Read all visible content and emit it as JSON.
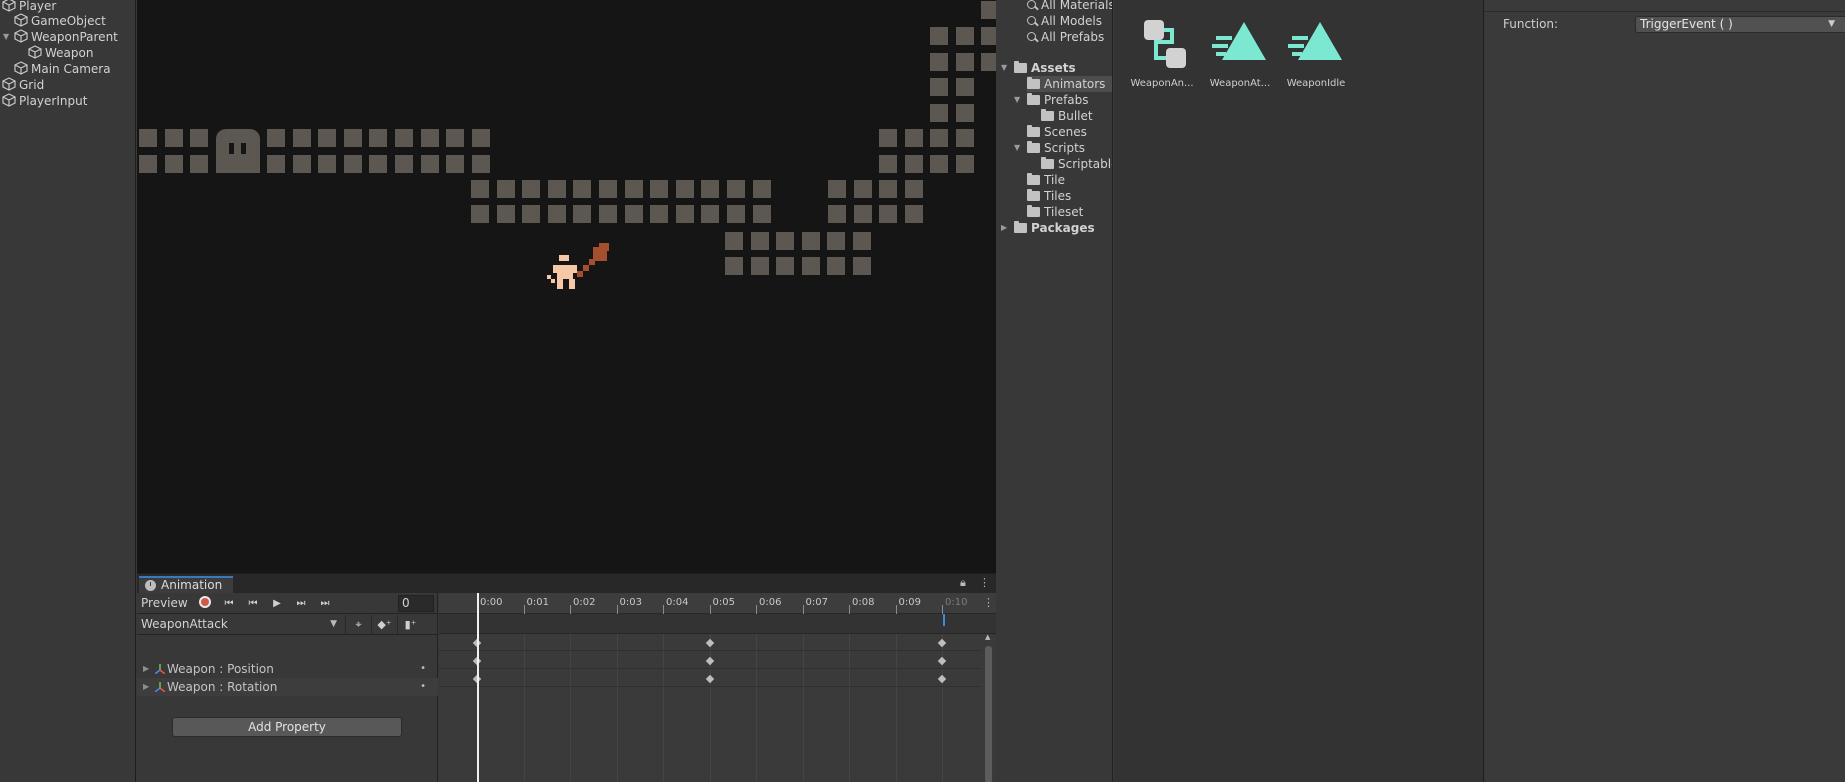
{
  "hierarchy": {
    "items": [
      {
        "label": "Player"
      },
      {
        "label": "GameObject"
      },
      {
        "label": "WeaponParent"
      },
      {
        "label": "Weapon"
      },
      {
        "label": "Main Camera"
      },
      {
        "label": "Grid"
      },
      {
        "label": "PlayerInput"
      }
    ]
  },
  "animation": {
    "tab_title": "Animation",
    "preview_label": "Preview",
    "frame_value": "0",
    "clip_name": "WeaponAttack",
    "ruler_ticks": [
      "0:00",
      "0:01",
      "0:02",
      "0:03",
      "0:04",
      "0:05",
      "0:06",
      "0:07",
      "0:08",
      "0:09",
      "0:10"
    ],
    "properties": [
      {
        "label": "Weapon : Position"
      },
      {
        "label": "Weapon : Rotation"
      }
    ],
    "add_property_label": "Add Property"
  },
  "project": {
    "searches": [
      "All Materials",
      "All Models",
      "All Prefabs"
    ],
    "tree": [
      {
        "label": "Assets"
      },
      {
        "label": "Animators"
      },
      {
        "label": "Prefabs"
      },
      {
        "label": "Bullet"
      },
      {
        "label": "Scenes"
      },
      {
        "label": "Scripts"
      },
      {
        "label": "Scriptable"
      },
      {
        "label": "Tile"
      },
      {
        "label": "Tiles"
      },
      {
        "label": "Tileset"
      },
      {
        "label": "Packages"
      }
    ],
    "assets": [
      {
        "label": "WeaponAn...",
        "icon": "animator-controller-icon"
      },
      {
        "label": "WeaponAt...",
        "icon": "animation-clip-icon"
      },
      {
        "label": "WeaponIdle",
        "icon": "animation-clip-icon"
      }
    ],
    "accent_color": "#7de8d2"
  },
  "inspector": {
    "function_label": "Function:",
    "function_value": "TriggerEvent ( )"
  }
}
